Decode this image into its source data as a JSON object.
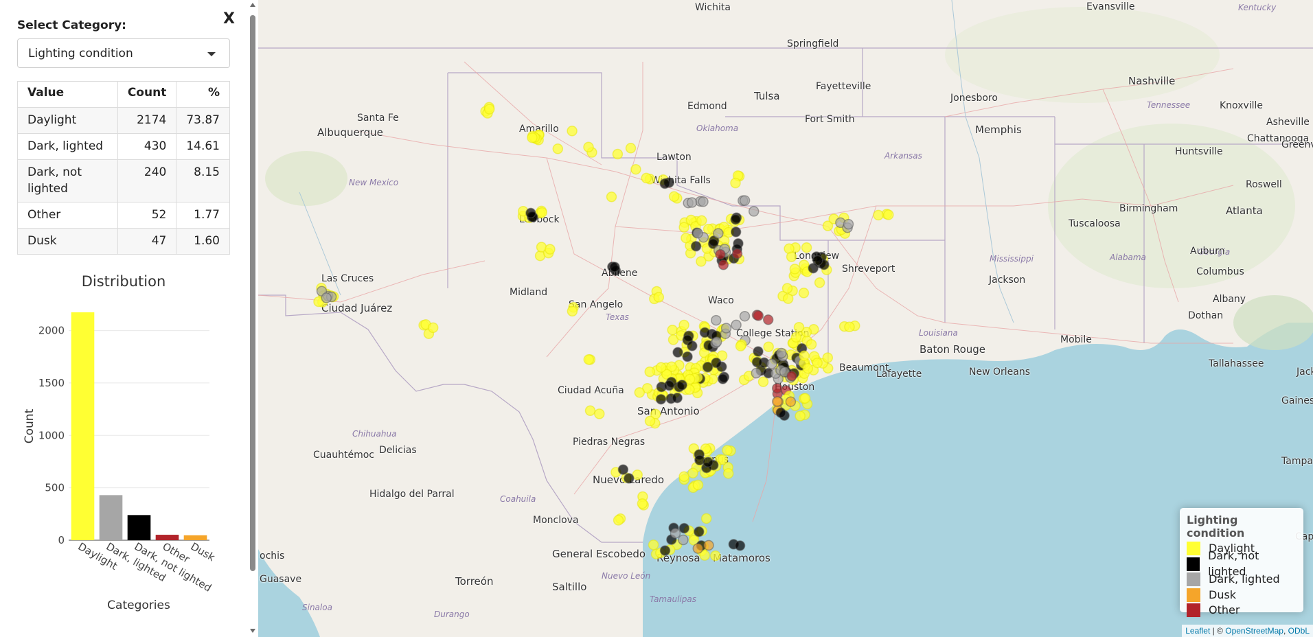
{
  "sidebar": {
    "close_label": "X",
    "select_label": "Select Category:",
    "select_value": "Lighting condition",
    "table": {
      "headers": [
        "Value",
        "Count",
        "%"
      ],
      "rows": [
        {
          "value": "Daylight",
          "count": "2174",
          "pct": "73.87"
        },
        {
          "value": "Dark, lighted",
          "count": "430",
          "pct": "14.61"
        },
        {
          "value": "Dark, not lighted",
          "count": "240",
          "pct": "8.15"
        },
        {
          "value": "Other",
          "count": "52",
          "pct": "1.77"
        },
        {
          "value": "Dusk",
          "count": "47",
          "pct": "1.60"
        }
      ]
    }
  },
  "chart_data": {
    "type": "bar",
    "title": "Distribution",
    "xlabel": "Categories",
    "ylabel": "Count",
    "categories": [
      "Daylight",
      "Dark, lighted",
      "Dark, not lighted",
      "Other",
      "Dusk"
    ],
    "values": [
      2174,
      430,
      240,
      52,
      47
    ],
    "colors": [
      "#ffff33",
      "#a6a6a6",
      "#000000",
      "#b2232a",
      "#f5a52a"
    ],
    "yticks": [
      0,
      500,
      1000,
      1500,
      2000
    ],
    "ylim": [
      0,
      2174
    ],
    "grid": true
  },
  "map": {
    "cities": [
      "Wichita",
      "Springfield",
      "Evansville",
      "Kentucky",
      "Tulsa",
      "Fayetteville",
      "Nashville",
      "Tennessee",
      "Knoxville",
      "Edmond",
      "Jonesboro",
      "Asheville",
      "Santa Fe",
      "Albuquerque",
      "Amarillo",
      "Oklahoma",
      "Fort Smith",
      "Memphis",
      "Chattanooga",
      "Lawton",
      "Arkansas",
      "Greenville",
      "New Mexico",
      "Wichita Falls",
      "Huntsville",
      "Roswell",
      "Birmingham",
      "Atlanta",
      "Lubbock",
      "Tuscaloosa",
      "Longview",
      "Shreveport",
      "Mississippi",
      "Alabama",
      "Georgia",
      "Auburn",
      "Las Cruces",
      "Abilene",
      "Midland",
      "Columbus",
      "Ciudad Juárez",
      "San Angelo",
      "Waco",
      "Jackson",
      "Albany",
      "Texas",
      "College Station",
      "Dothan",
      "Louisiana",
      "Baton Rouge",
      "Mobile",
      "Tallahassee",
      "Lafayette",
      "New Orleans",
      "Beaumont",
      "Jack",
      "Houston",
      "Gainesville",
      "Ciudad Acuña",
      "San Antonio",
      "Chihuahua",
      "Piedras Negras",
      "Cuauhtémoc",
      "Delicias",
      "Corpus",
      "Tampa",
      "Nuevo Laredo",
      "Coahuila",
      "Hidalgo del Parral",
      "Monclova",
      "General Escobedo",
      "Reynosa",
      "Matamoros",
      "Nuevo León",
      "Torreón",
      "Saltillo",
      "Tamaulipas",
      "Guasave",
      "Sinaloa",
      "Durango",
      "ochis",
      "Cape"
    ]
  },
  "legend": {
    "title": "Lighting condition",
    "items": [
      {
        "label": "Daylight",
        "color": "#ffff33"
      },
      {
        "label": "Dark, not lighted",
        "color": "#000000"
      },
      {
        "label": "Dark, lighted",
        "color": "#a6a6a6"
      },
      {
        "label": "Dusk",
        "color": "#f5a52a"
      },
      {
        "label": "Other",
        "color": "#b2232a"
      }
    ]
  },
  "attribution": {
    "leaflet": "Leaflet",
    "sep": " | © ",
    "osm": "OpenStreetMap",
    "comma": ", ",
    "odbl": "ODbL"
  }
}
